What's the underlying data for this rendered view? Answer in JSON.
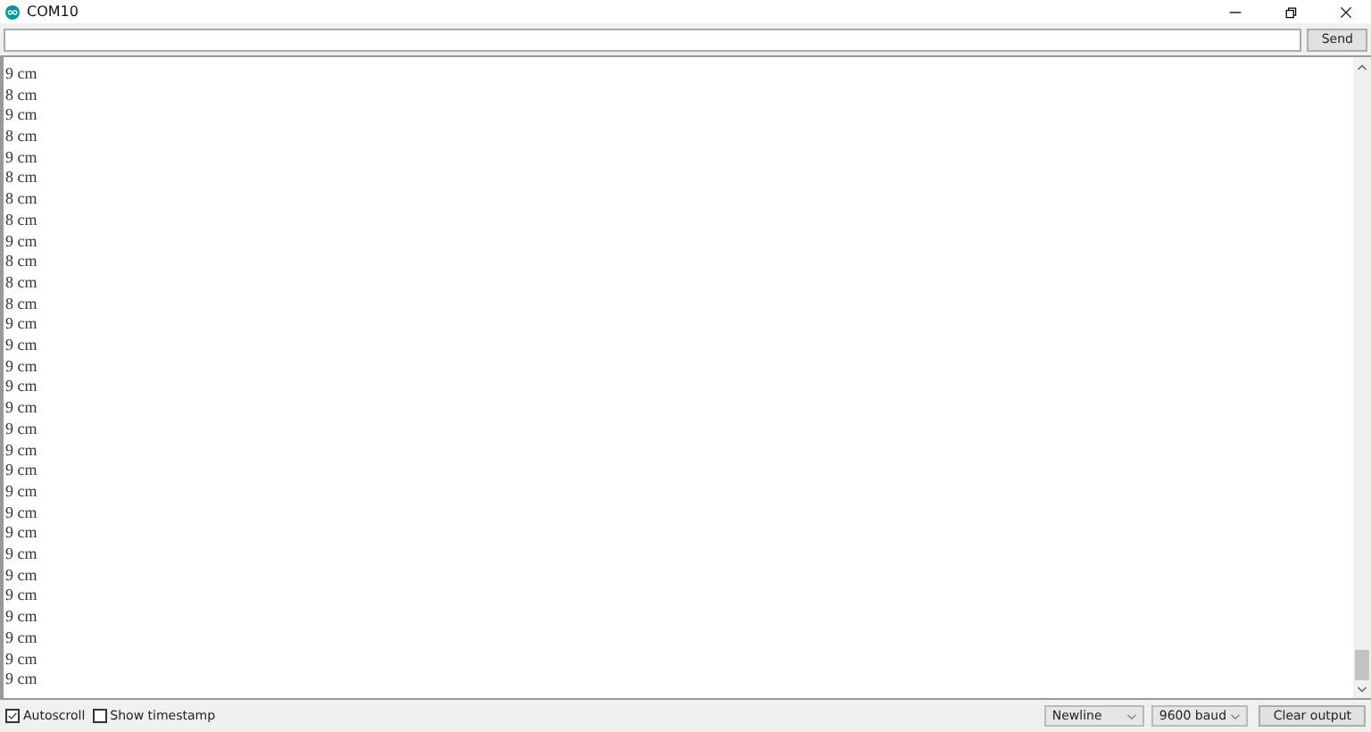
{
  "window": {
    "title": "COM10"
  },
  "send_button": "Send",
  "output_lines": [
    "9 cm",
    "8 cm",
    "9 cm",
    "8 cm",
    "9 cm",
    "8 cm",
    "8 cm",
    "8 cm",
    "9 cm",
    "8 cm",
    "8 cm",
    "8 cm",
    "9 cm",
    "9 cm",
    "9 cm",
    "9 cm",
    "9 cm",
    "9 cm",
    "9 cm",
    "9 cm",
    "9 cm",
    "9 cm",
    "9 cm",
    "9 cm",
    "9 cm",
    "9 cm",
    "9 cm",
    "9 cm",
    "9 cm",
    "9 cm"
  ],
  "autoscroll": {
    "label": "Autoscroll",
    "checked": true
  },
  "show_timestamp": {
    "label": "Show timestamp",
    "checked": false
  },
  "line_ending": "Newline",
  "baud_rate": "9600 baud",
  "clear_button": "Clear output"
}
